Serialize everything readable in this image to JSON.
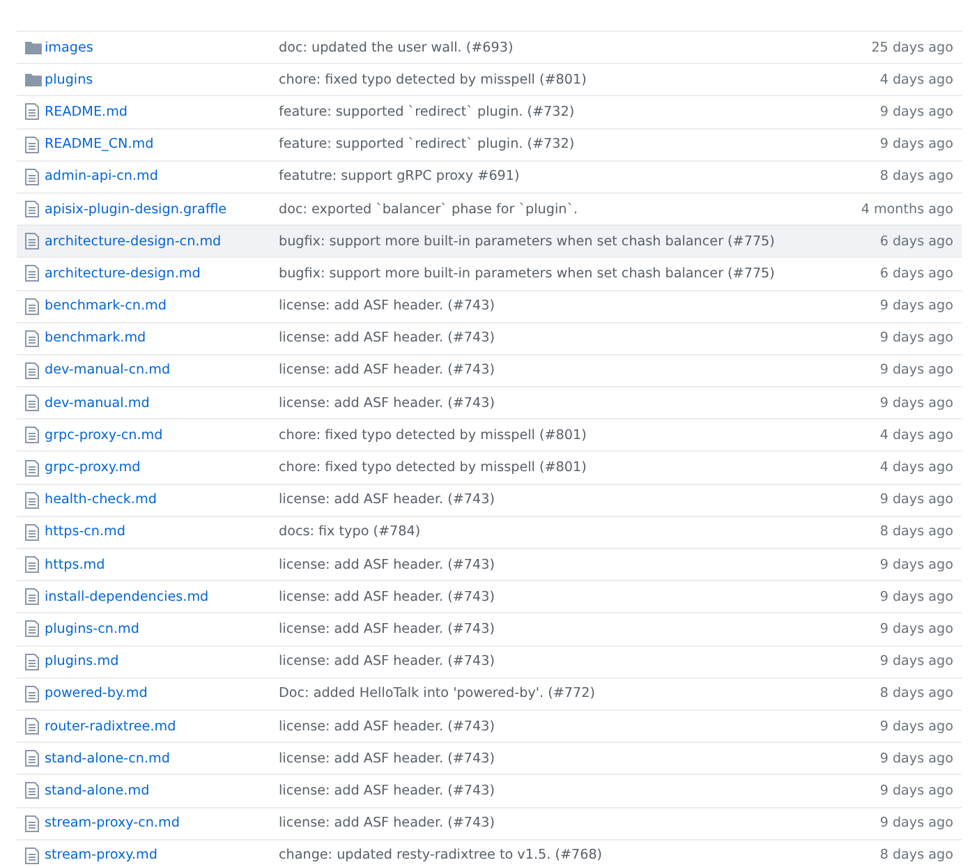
{
  "files": [
    {
      "kind": "folder",
      "name": "images",
      "message": "doc: updated the user wall. (#693)",
      "age": "25 days ago",
      "highlighted": false
    },
    {
      "kind": "folder",
      "name": "plugins",
      "message": "chore: fixed typo detected by misspell (#801)",
      "age": "4 days ago",
      "highlighted": false
    },
    {
      "kind": "file",
      "name": "README.md",
      "message": "feature: supported `redirect` plugin. (#732)",
      "age": "9 days ago",
      "highlighted": false
    },
    {
      "kind": "file",
      "name": "README_CN.md",
      "message": "feature: supported `redirect` plugin. (#732)",
      "age": "9 days ago",
      "highlighted": false
    },
    {
      "kind": "file",
      "name": "admin-api-cn.md",
      "message": "featutre: support gRPC proxy #691)",
      "age": "8 days ago",
      "highlighted": false
    },
    {
      "kind": "file",
      "name": "apisix-plugin-design.graffle",
      "message": "doc: exported `balancer` phase for `plugin`.",
      "age": "4 months ago",
      "highlighted": false
    },
    {
      "kind": "file",
      "name": "architecture-design-cn.md",
      "message": "bugfix: support more built-in parameters when set chash balancer (#775)",
      "age": "6 days ago",
      "highlighted": true
    },
    {
      "kind": "file",
      "name": "architecture-design.md",
      "message": "bugfix: support more built-in parameters when set chash balancer (#775)",
      "age": "6 days ago",
      "highlighted": false
    },
    {
      "kind": "file",
      "name": "benchmark-cn.md",
      "message": "license: add ASF header. (#743)",
      "age": "9 days ago",
      "highlighted": false
    },
    {
      "kind": "file",
      "name": "benchmark.md",
      "message": "license: add ASF header. (#743)",
      "age": "9 days ago",
      "highlighted": false
    },
    {
      "kind": "file",
      "name": "dev-manual-cn.md",
      "message": "license: add ASF header. (#743)",
      "age": "9 days ago",
      "highlighted": false
    },
    {
      "kind": "file",
      "name": "dev-manual.md",
      "message": "license: add ASF header. (#743)",
      "age": "9 days ago",
      "highlighted": false
    },
    {
      "kind": "file",
      "name": "grpc-proxy-cn.md",
      "message": "chore: fixed typo detected by misspell (#801)",
      "age": "4 days ago",
      "highlighted": false
    },
    {
      "kind": "file",
      "name": "grpc-proxy.md",
      "message": "chore: fixed typo detected by misspell (#801)",
      "age": "4 days ago",
      "highlighted": false
    },
    {
      "kind": "file",
      "name": "health-check.md",
      "message": "license: add ASF header. (#743)",
      "age": "9 days ago",
      "highlighted": false
    },
    {
      "kind": "file",
      "name": "https-cn.md",
      "message": "docs: fix typo (#784)",
      "age": "8 days ago",
      "highlighted": false
    },
    {
      "kind": "file",
      "name": "https.md",
      "message": "license: add ASF header. (#743)",
      "age": "9 days ago",
      "highlighted": false
    },
    {
      "kind": "file",
      "name": "install-dependencies.md",
      "message": "license: add ASF header. (#743)",
      "age": "9 days ago",
      "highlighted": false
    },
    {
      "kind": "file",
      "name": "plugins-cn.md",
      "message": "license: add ASF header. (#743)",
      "age": "9 days ago",
      "highlighted": false
    },
    {
      "kind": "file",
      "name": "plugins.md",
      "message": "license: add ASF header. (#743)",
      "age": "9 days ago",
      "highlighted": false
    },
    {
      "kind": "file",
      "name": "powered-by.md",
      "message": "Doc: added HelloTalk into 'powered-by'. (#772)",
      "age": "8 days ago",
      "highlighted": false
    },
    {
      "kind": "file",
      "name": "router-radixtree.md",
      "message": "license: add ASF header. (#743)",
      "age": "9 days ago",
      "highlighted": false
    },
    {
      "kind": "file",
      "name": "stand-alone-cn.md",
      "message": "license: add ASF header. (#743)",
      "age": "9 days ago",
      "highlighted": false
    },
    {
      "kind": "file",
      "name": "stand-alone.md",
      "message": "license: add ASF header. (#743)",
      "age": "9 days ago",
      "highlighted": false
    },
    {
      "kind": "file",
      "name": "stream-proxy-cn.md",
      "message": "license: add ASF header. (#743)",
      "age": "9 days ago",
      "highlighted": false
    },
    {
      "kind": "file",
      "name": "stream-proxy.md",
      "message": "change: updated resty-radixtree to v1.5. (#768)",
      "age": "8 days ago",
      "highlighted": false
    }
  ]
}
